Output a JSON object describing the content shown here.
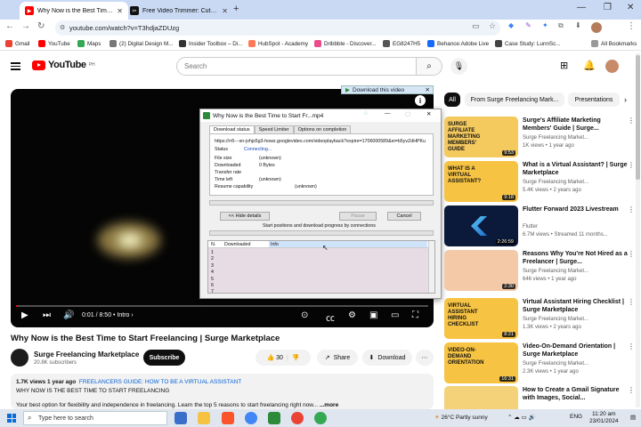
{
  "browser": {
    "tabs": [
      {
        "title": "Why Now is the Best Time to St",
        "active": true
      },
      {
        "title": "Free Video Trimmer: Cut Video",
        "active": false
      }
    ],
    "url": "youtube.com/watch?v=T3hdjaZDUzg",
    "bookmarks": [
      "Gmail",
      "YouTube",
      "Maps",
      "(2) Digital Design M...",
      "Insider Toolbox – Di...",
      "HubSpot - Academy",
      "Dribbble - Discover...",
      "EG8247H5",
      "Behance:Adobe Live",
      "Case Study: LunnSc..."
    ],
    "all_bookmarks": "All Bookmarks"
  },
  "youtube": {
    "logo_text": "YouTube",
    "logo_sup": "PH",
    "search_placeholder": "Search"
  },
  "player": {
    "time": "0:01 / 8:50",
    "chapter": "Intro",
    "progress": 0.002,
    "download_bar": "Download this video"
  },
  "idm": {
    "title": "Why Now is the Best Time to Start Fr...mp4",
    "tabs": [
      "Download status",
      "Speed Limiter",
      "Options on completion"
    ],
    "url": "https://rr5---sn-jvhjs5g3-howz.googlevideo.com/videoplayback?expire=1706000589&ei=b5yvZdHPKu",
    "status_label": "Status",
    "status_value": "Connecting...",
    "fields": [
      {
        "label": "File size",
        "value": "(unknown)"
      },
      {
        "label": "Downloaded",
        "value": "0 Bytes"
      },
      {
        "label": "Transfer rate",
        "value": ""
      },
      {
        "label": "Time left",
        "value": "(unknown)"
      }
    ],
    "resume_label": "Resume capability",
    "resume_value": "(unknown)",
    "hide_details": "<< Hide details",
    "pause": "Pause",
    "cancel": "Cancel",
    "connections_caption": "Start positions and download progress by connections",
    "table_headers": [
      "N.",
      "Downloaded",
      "Info"
    ],
    "rows": [
      "1",
      "2",
      "3",
      "4",
      "5",
      "6",
      "7"
    ]
  },
  "video": {
    "title": "Why Now is the Best Time to Start Freelancing | Surge Marketplace",
    "channel": "Surge Freelancing Marketplace",
    "subscribers": "20.8K subscribers",
    "subscribe": "Subscribe",
    "likes": "30",
    "share": "Share",
    "download": "Download",
    "views_line": "1.7K views  1 year ago",
    "hashtags": "FREELANCERS GUIDE: HOW TO BE A VIRTUAL ASSISTANT",
    "desc_line2": "WHY NOW IS THE BEST TIME TO START FREELANCING",
    "desc_line3": "Your best option for flexibility and independence in freelancing. Learn the top 5 reasons to start freelancing right now...",
    "more": "...more"
  },
  "chips": [
    "All",
    "From Surge Freelancing Mark...",
    "Presentations"
  ],
  "recommendations": [
    {
      "title": "Surge's Affiliate Marketing Members' Guide | Surge...",
      "channel": "Surge Freelancing Market...",
      "meta": "1K views • 1 year ago",
      "duration": "9:53",
      "thumb_text": "SURGE AFFILIATE MARKETING MEMBERS' GUIDE",
      "bg": "#f4c95d"
    },
    {
      "title": "What is a Virtual Assistant? | Surge Marketplace",
      "channel": "Surge Freelancing Market...",
      "meta": "5.4K views • 2 years ago",
      "duration": "9:18",
      "thumb_text": "WHAT IS A VIRTUAL ASSISTANT?",
      "bg": "#f6c343"
    },
    {
      "title": "Flutter Forward 2023 Livestream",
      "channel": "Flutter",
      "meta": "6.7M views • Streamed 11 months...",
      "duration": "2:26:59",
      "thumb_text": "",
      "bg": "#0b1a3a"
    },
    {
      "title": "Reasons Why You're Not Hired as a Freelancer | Surge...",
      "channel": "Surge Freelancing Market...",
      "meta": "646 views • 1 year ago",
      "duration": "2:30",
      "thumb_text": "",
      "bg": "#f3c9a8"
    },
    {
      "title": "Virtual Assistant Hiring Checklist | Surge Marketplace",
      "channel": "Surge Freelancing Market...",
      "meta": "1.3K views • 2 years ago",
      "duration": "8:21",
      "thumb_text": "VIRTUAL ASSISTANT HIRING CHECKLIST",
      "bg": "#f6c343"
    },
    {
      "title": "Video-On-Demand Orientation | Surge Marketplace",
      "channel": "Surge Freelancing Market...",
      "meta": "2.3K views • 1 year ago",
      "duration": "16:31",
      "thumb_text": "VIDEO-ON-DEMAND ORIENTATION",
      "bg": "#f6c343"
    },
    {
      "title": "How to Create a Gmail Signature with Images, Social...",
      "channel": "",
      "meta": "",
      "duration": "",
      "thumb_text": "",
      "bg": "#f4d27a"
    }
  ],
  "taskbar": {
    "search_placeholder": "Type here to search",
    "weather": "26°C  Partly sunny",
    "lang": "ENG",
    "time": "11:20 am",
    "date": "23/01/2024"
  }
}
